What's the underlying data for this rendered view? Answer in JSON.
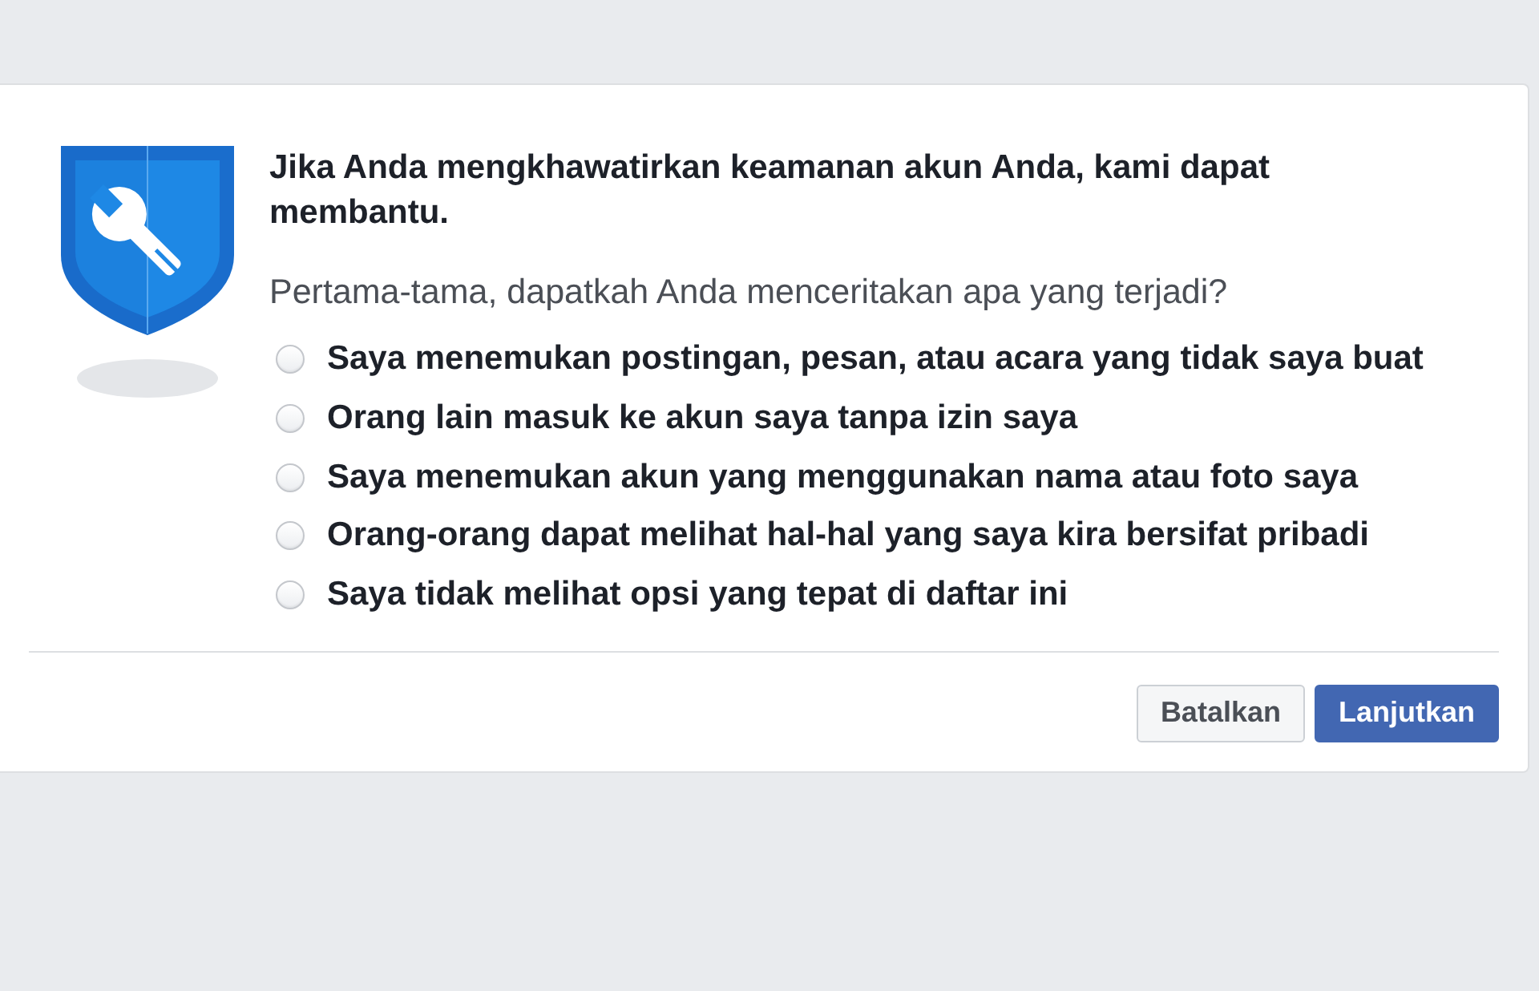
{
  "dialog": {
    "heading": "Jika Anda mengkhawatirkan keamanan akun Anda, kami dapat membantu.",
    "question": "Pertama-tama, dapatkah Anda menceritakan apa yang terjadi?",
    "options": [
      {
        "label": "Saya menemukan postingan, pesan, atau acara yang tidak saya buat",
        "selected": false
      },
      {
        "label": "Orang lain masuk ke akun saya tanpa izin saya",
        "selected": false
      },
      {
        "label": "Saya menemukan akun yang menggunakan nama atau foto saya",
        "selected": false
      },
      {
        "label": "Orang-orang dapat melihat hal-hal yang saya kira bersifat pribadi",
        "selected": false
      },
      {
        "label": "Saya tidak melihat opsi yang tepat di daftar ini",
        "selected": false
      }
    ],
    "buttons": [
      {
        "label": "Batalkan",
        "kind": "secondary"
      },
      {
        "label": "Lanjutkan",
        "kind": "primary"
      }
    ]
  }
}
